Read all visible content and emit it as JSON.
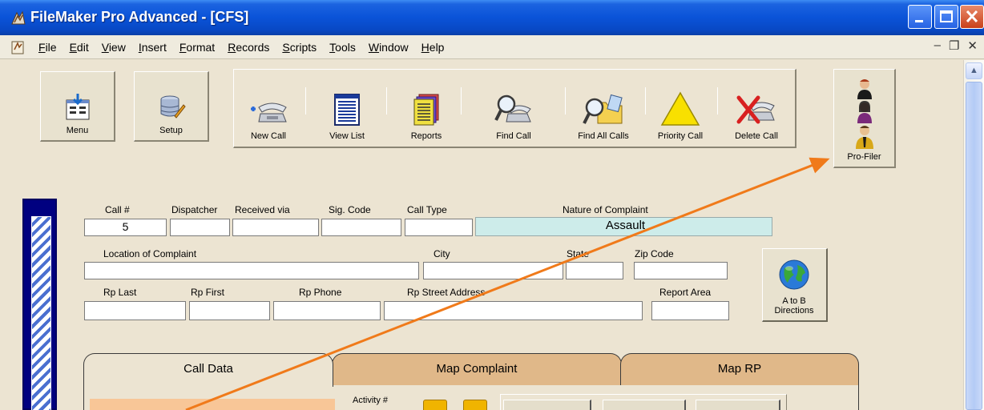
{
  "window": {
    "title": "FileMaker Pro Advanced - [CFS]"
  },
  "menu": {
    "items": [
      "File",
      "Edit",
      "View",
      "Insert",
      "Format",
      "Records",
      "Scripts",
      "Tools",
      "Window",
      "Help"
    ]
  },
  "toolbar": {
    "menu_label": "Menu",
    "setup_label": "Setup",
    "new_call": "New Call",
    "view_list": "View List",
    "reports": "Reports",
    "find_call": "Find Call",
    "find_all_calls": "Find All Calls",
    "priority_call": "Priority Call",
    "delete_call": "Delete Call",
    "pro_filer": "Pro-Filer"
  },
  "form": {
    "call_no_label": "Call #",
    "call_no_value": "5",
    "dispatcher_label": "Dispatcher",
    "received_via_label": "Received via",
    "sig_code_label": "Sig. Code",
    "call_type_label": "Call Type",
    "nature_label": "Nature of Complaint",
    "nature_value": "Assault",
    "location_label": "Location of Complaint",
    "city_label": "City",
    "state_label": "State",
    "zip_label": "Zip Code",
    "rp_last_label": "Rp Last",
    "rp_first_label": "Rp First",
    "rp_phone_label": "Rp Phone",
    "rp_street_label": "Rp Street Address",
    "report_area_label": "Report Area",
    "ab_directions_line1": "A to B",
    "ab_directions_line2": "Directions"
  },
  "tabs": [
    "Call Data",
    "Map Complaint",
    "Map RP"
  ],
  "panel": {
    "activity_label": "Activity #"
  },
  "colors": {
    "accent_arrow": "#F07A1A",
    "nature_bg": "#CDECEA",
    "tab_inactive": "#E0B889"
  }
}
